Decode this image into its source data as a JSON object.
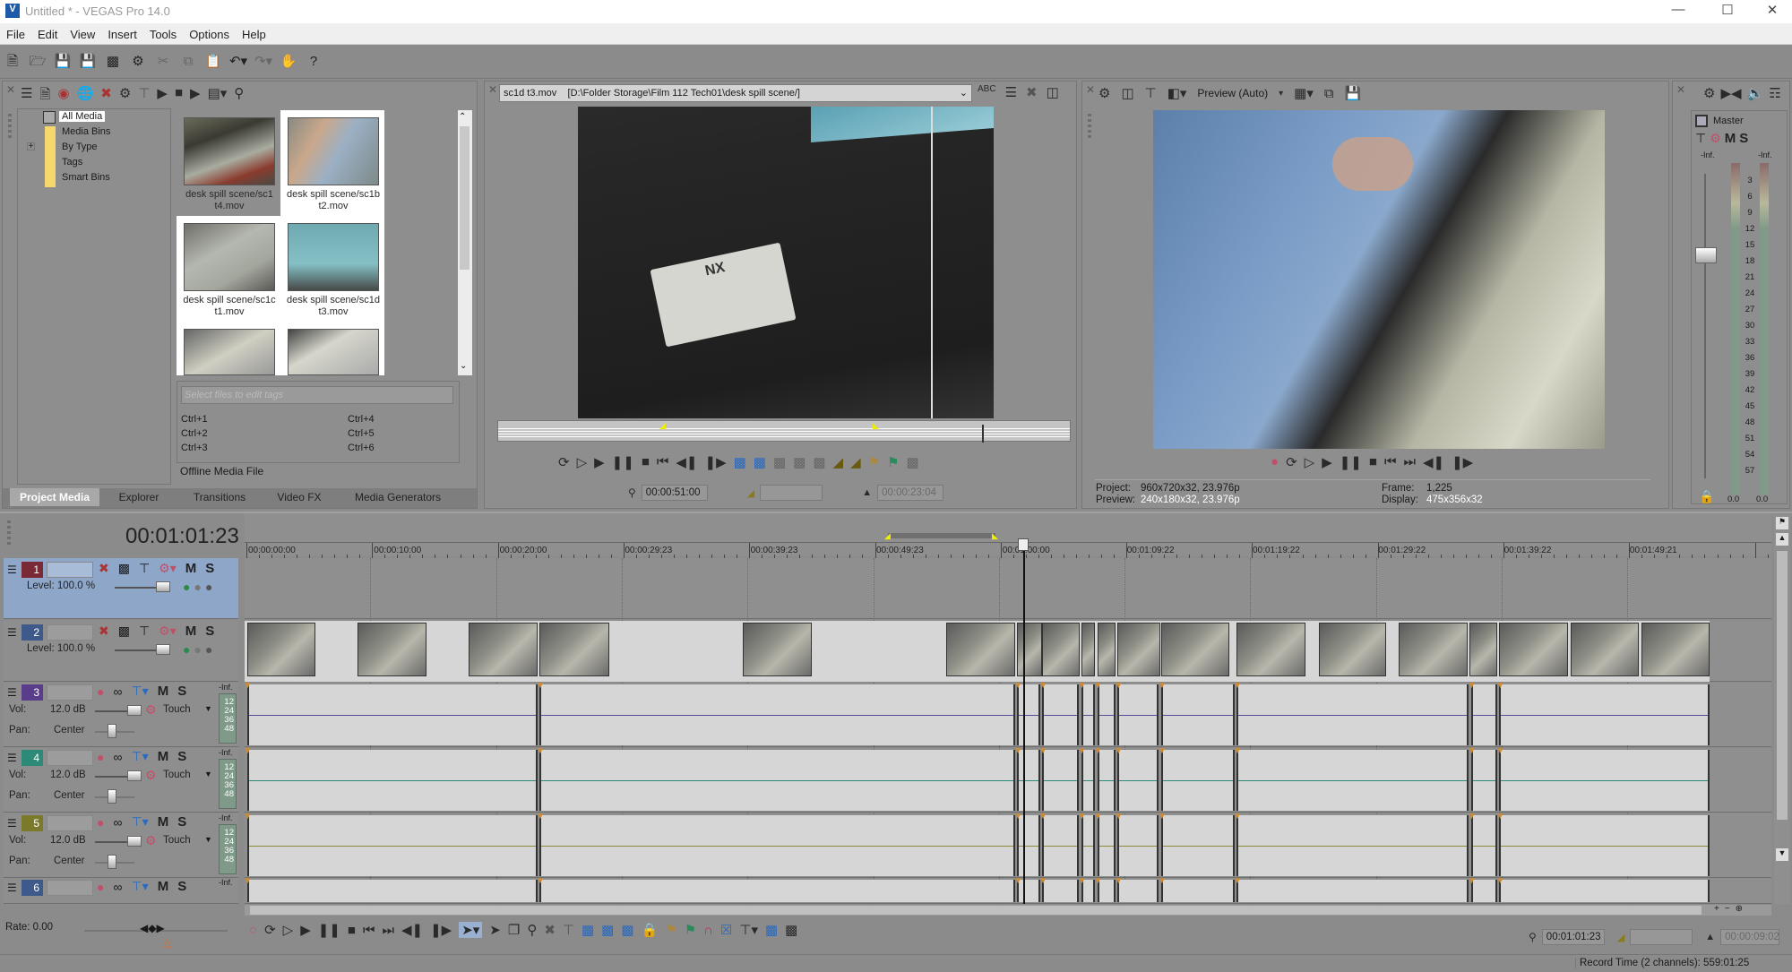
{
  "window": {
    "title": "Untitled * - VEGAS Pro 14.0",
    "logo": "V"
  },
  "menu": [
    "File",
    "Edit",
    "View",
    "Insert",
    "Tools",
    "Options",
    "Help"
  ],
  "toolbar_icons": [
    "new-icon",
    "open-icon",
    "save-icon",
    "save-as-icon",
    "render-icon",
    "properties-icon",
    "cut-icon",
    "copy-icon",
    "paste-icon",
    "undo-icon",
    "redo-icon",
    "enable-snapping-icon",
    "help-icon"
  ],
  "project_media": {
    "tree": [
      "All Media",
      "Media Bins",
      "By Type",
      "Tags",
      "Smart Bins"
    ],
    "selected_tree": "All Media",
    "thumbnails": [
      {
        "line1": "desk spill scene/sc1",
        "line2": "t4.mov"
      },
      {
        "line1": "desk spill scene/sc1b",
        "line2": "t2.mov"
      },
      {
        "line1": "desk spill scene/sc1c",
        "line2": "t1.mov"
      },
      {
        "line1": "desk spill scene/sc1d",
        "line2": "t3.mov"
      }
    ],
    "tags_placeholder": "Select files to edit tags",
    "shortcuts": [
      "Ctrl+1",
      "Ctrl+2",
      "Ctrl+3",
      "Ctrl+4",
      "Ctrl+5",
      "Ctrl+6"
    ],
    "status": "Offline Media File"
  },
  "dock_tabs": [
    "Project Media",
    "Explorer",
    "Transitions",
    "Video FX",
    "Media Generators"
  ],
  "active_tab": "Project Media",
  "trimmer": {
    "file": "sc1d t3.mov",
    "path": "[D:\\Folder Storage\\Film 112 Tech01\\desk spill scene/]",
    "cursor": "00:00:51:00",
    "selection_length": "",
    "duration": "00:00:23:04",
    "label_text": "NX"
  },
  "preview": {
    "quality": "Preview (Auto)",
    "project_label": "Project:",
    "project_value": "960x720x32, 23.976p",
    "preview_label": "Preview:",
    "preview_value": "240x180x32, 23.976p",
    "frame_label": "Frame:",
    "frame_value": "1,225",
    "display_label": "Display:",
    "display_value": "475x356x32"
  },
  "master": {
    "title": "Master",
    "m": "M",
    "s": "S",
    "peak_left": "-Inf.",
    "peak_right": "-Inf.",
    "scale": [
      "3",
      "6",
      "9",
      "12",
      "15",
      "18",
      "21",
      "24",
      "27",
      "30",
      "33",
      "36",
      "39",
      "42",
      "45",
      "48",
      "51",
      "54",
      "57"
    ],
    "value_left": "0.0",
    "value_right": "0.0"
  },
  "timeline": {
    "cursor_time": "00:01:01:23",
    "ruler": [
      "00:00:00:00",
      "00:00:10:00",
      "00:00:20:00",
      "00:00:29:23",
      "00:00:39:23",
      "00:00:49:23",
      "00:01:00:00",
      "00:01:09:22",
      "00:01:19:22",
      "00:01:29:22",
      "00:01:39:22",
      "00:01:49:21"
    ],
    "video_tracks": [
      {
        "num": "1",
        "color": "#7a2a36",
        "level": "Level: 100.0 %",
        "selected": true
      },
      {
        "num": "2",
        "color": "#3d5a8a",
        "level": "Level: 100.0 %",
        "selected": false
      }
    ],
    "audio_tracks": [
      {
        "num": "3",
        "color": "#5a3d8a",
        "vol_label": "Vol:",
        "vol": "12.0 dB",
        "pan_label": "Pan:",
        "pan": "Center",
        "mode": "Touch",
        "peak": "-Inf.",
        "wave": "#5a4a9a"
      },
      {
        "num": "4",
        "color": "#2d8a78",
        "vol_label": "Vol:",
        "vol": "12.0 dB",
        "pan_label": "Pan:",
        "pan": "Center",
        "mode": "Touch",
        "peak": "-Inf.",
        "wave": "#2d8a78"
      },
      {
        "num": "5",
        "color": "#7a7a2a",
        "vol_label": "Vol:",
        "vol": "12.0 dB",
        "pan_label": "Pan:",
        "pan": "Center",
        "mode": "Touch",
        "peak": "-Inf.",
        "wave": "#8a8a3a"
      },
      {
        "num": "6",
        "color": "#3d5a8a",
        "peak": "-Inf."
      }
    ],
    "meter_scale": [
      "12",
      "24",
      "36",
      "48"
    ],
    "m": "M",
    "s": "S",
    "rate": "Rate: 0.00"
  },
  "transport": {
    "cursor": "00:01:01:23",
    "selection": "",
    "length": "00:00:09:02"
  },
  "status": {
    "record_time": "Record Time (2 channels): 559:01:25"
  }
}
